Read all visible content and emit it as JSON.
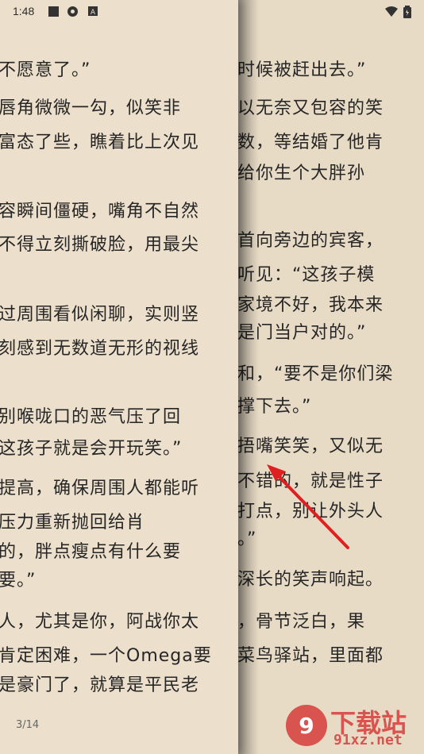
{
  "status": {
    "time": "1:48",
    "icons": [
      "notification-square-icon",
      "app-icon",
      "a-icon"
    ],
    "right_icons": [
      "wifi-icon",
      "battery-icon"
    ]
  },
  "left_page": {
    "lines": [
      "不愿意了。”",
      "唇角微微一勾，似笑非",
      "富态了些，瞧着比上次见",
      "容瞬间僵硬，嘴角不自然",
      "不得立刻撕破脸，用最尖",
      "过周围看似闲聊，实则竖",
      "刻感到无数道无形的视线",
      "别喉咙口的恶气压了回",
      "这孩子就是会开玩笑。”",
      "提高，确保周围人都能听",
      "压力重新抛回给肖",
      "的，胖点瘦点有什么要",
      "要。”",
      "人，尤其是你，阿战你太",
      "肯定困难，一个Omega要",
      "是豪门了，就算是平民老"
    ],
    "page_number": "3/14"
  },
  "right_page": {
    "lines": [
      "时候被赶出去。”",
      "以无奈又包容的笑",
      "数，等结婚了他肯",
      "给你生个大胖孙",
      "首向旁边的宾客，",
      "听见：“这孩子模",
      "家境不好，我本来",
      "是门当户对的。”",
      "和，“要不是你们梁",
      "撑下去。”",
      "捂嘴笑笑，又似无",
      "不错的，就是性子",
      "打点，别让外头人",
      "。”",
      "深长的笑声响起。",
      "，骨节泛白，果",
      "菜鸟驿站，里面都"
    ]
  },
  "watermark": {
    "brand": "下载站",
    "url": "91xz.net",
    "color": "#d9534f"
  },
  "colors": {
    "page_bg": "#ecdfcb",
    "text": "#262626",
    "arrow": "#e02020"
  }
}
